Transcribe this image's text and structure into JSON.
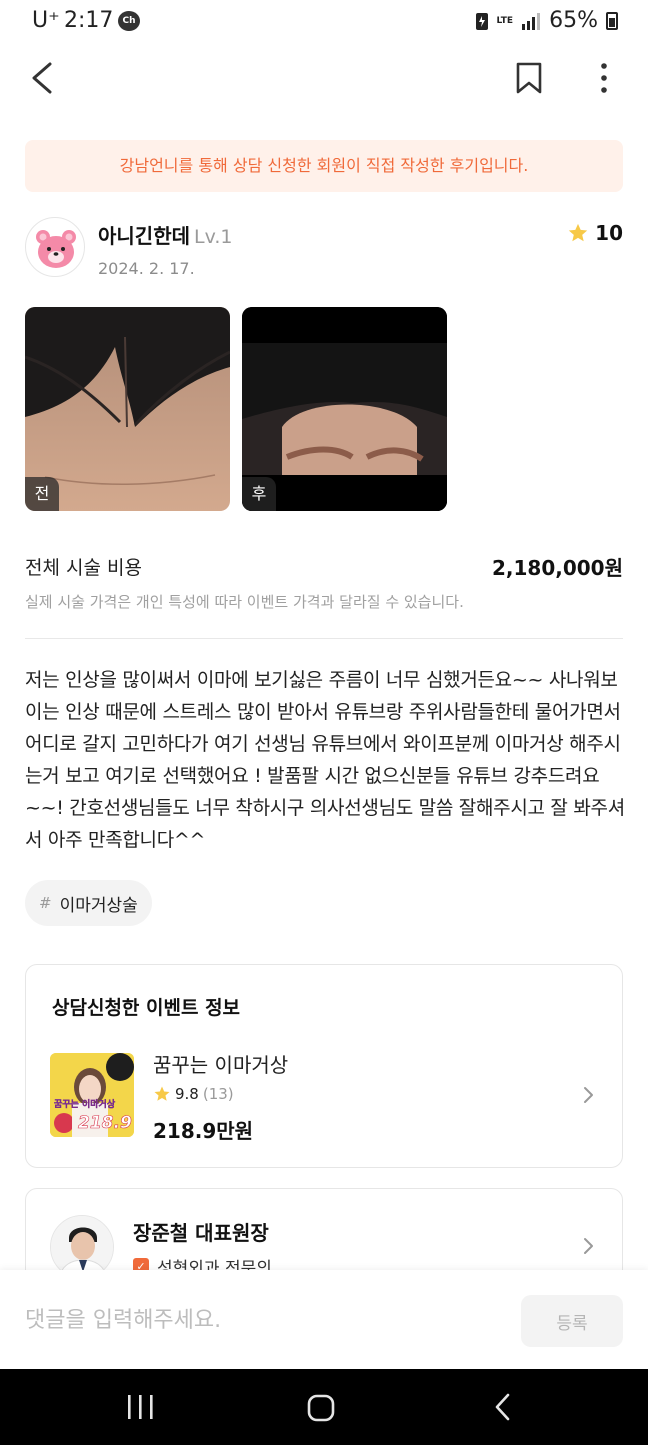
{
  "status_bar": {
    "carrier": "U⁺",
    "time": "2:17",
    "notification_icon": "Ch",
    "network": "LTE",
    "battery": "65%"
  },
  "notice": "강남언니를 통해 상담 신청한 회원이 직접 작성한 후기입니다.",
  "review": {
    "author": "아니긴한데",
    "level": "Lv.1",
    "date": "2024. 2. 17.",
    "rating": "10",
    "photos": [
      {
        "tag": "전"
      },
      {
        "tag": "후"
      }
    ],
    "cost_label": "전체 시술 비용",
    "cost_value": "2,180,000원",
    "cost_note": "실제 시술 가격은 개인 특성에 따라 이벤트 가격과 달라질 수 있습니다.",
    "body": "저는 인상을 많이써서 이마에 보기싫은 주름이 너무 심했거든요~~ 사나워보이는 인상 때문에 스트레스 많이 받아서 유튜브랑 주위사람들한테 물어가면서 어디로 갈지 고민하다가 여기 선생님 유튜브에서 와이프분께 이마거상 해주시는거 보고 여기로 선택했어요 ! 발품팔 시간 없으신분들 유튜브 강추드려요~~! 간호선생님들도 너무 착하시구 의사선생님도 말씀 잘해주시고 잘 봐주셔서 아주 만족합니다^^",
    "hashtag_symbol": "#",
    "hashtag": "이마거상술"
  },
  "event_card": {
    "title": "상담신청한 이벤트 정보",
    "thumb_text": "꿈꾸는 이마거상",
    "thumb_price": "218.9",
    "name": "꿈꾸는 이마거상",
    "rating": "9.8",
    "rating_count": "(13)",
    "price": "218.9만원"
  },
  "doctor_card": {
    "name": "장준철 대표원장",
    "specialty": "성형외과 전문의"
  },
  "comment": {
    "placeholder": "댓글을 입력해주세요.",
    "submit_label": "등록"
  },
  "colors": {
    "accent": "#f06a3a",
    "notice_bg": "#fff1ea",
    "star": "#f7c948"
  }
}
